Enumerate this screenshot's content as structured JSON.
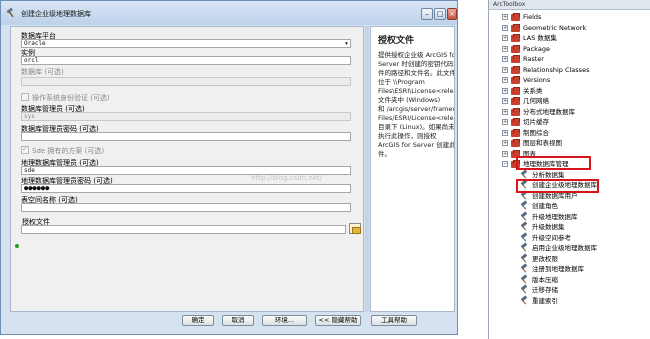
{
  "dialog": {
    "title": "创建企业级地理数据库",
    "buttons": {
      "ok": "确定",
      "cancel": "取消",
      "env": "环境...",
      "hide_help": "<< 隐藏帮助",
      "tool_help": "工具帮助"
    },
    "fields": {
      "platform_label": "数据库平台",
      "platform_value": "Oracle",
      "instance_label": "实例",
      "instance_value": "orcl",
      "database_label": "数据库 (可选)",
      "os_auth_label": "操作系统身份验证 (可选)",
      "db_admin_label": "数据库管理员 (可选)",
      "db_admin_value": "sys",
      "db_admin_pwd_label": "数据库管理员密码 (可选)",
      "sde_schema_label": "Sde 拥有的方案 (可选)",
      "gdb_admin_label": "地理数据库管理员 (可选)",
      "gdb_admin_value": "sde",
      "gdb_admin_pwd_label": "地理数据库管理员密码 (可选)",
      "gdb_admin_pwd_value": "●●●●●●",
      "tablespace_label": "表空间名称 (可选)",
      "auth_file_label": "授权文件"
    },
    "help": {
      "title": "授权文件",
      "body": "提供授权企业级 ArcGIS for\nServer 时创建的密钥代码文\n件的路径和文件名。此文件\n位于 \\\\Program\nFiles\\ESRI\\License<release#\n文件夹中 (Windows)\n和 /arcgis/server/framework/r\nFiles/ESRI/License<release#\n目录下 (Linux)。如果尚未\n执行此操作，则授权\nArcGIS for Server 创建此文\n件。"
    },
    "watermark": "http://blog.csdn.net/"
  },
  "toolbox": {
    "header": "ArcToolbox",
    "items": [
      {
        "label": "Fields",
        "kind": "box"
      },
      {
        "label": "Geometric Network",
        "kind": "box"
      },
      {
        "label": "LAS 数据集",
        "kind": "box"
      },
      {
        "label": "Package",
        "kind": "box"
      },
      {
        "label": "Raster",
        "kind": "box"
      },
      {
        "label": "Relationship Classes",
        "kind": "box"
      },
      {
        "label": "Versions",
        "kind": "box"
      },
      {
        "label": "关系类",
        "kind": "box"
      },
      {
        "label": "几何网络",
        "kind": "box"
      },
      {
        "label": "分布式地理数据库",
        "kind": "box"
      },
      {
        "label": "切片缓存",
        "kind": "box"
      },
      {
        "label": "制图综合",
        "kind": "box"
      },
      {
        "label": "图层和表视图",
        "kind": "box"
      },
      {
        "label": "图表",
        "kind": "box"
      },
      {
        "label": "地理数据库管理",
        "kind": "box"
      },
      {
        "label": "分析数据集",
        "kind": "tool"
      },
      {
        "label": "创建企业级地理数据库",
        "kind": "tool"
      },
      {
        "label": "创建数据库用户",
        "kind": "tool"
      },
      {
        "label": "创建角色",
        "kind": "tool"
      },
      {
        "label": "升级地理数据库",
        "kind": "tool"
      },
      {
        "label": "升级数据集",
        "kind": "tool"
      },
      {
        "label": "升级空间参考",
        "kind": "tool"
      },
      {
        "label": "启用企业级地理数据库",
        "kind": "tool"
      },
      {
        "label": "更改权限",
        "kind": "tool"
      },
      {
        "label": "注册到地理数据库",
        "kind": "tool"
      },
      {
        "label": "版本压缩",
        "kind": "tool"
      },
      {
        "label": "迁移存储",
        "kind": "tool"
      },
      {
        "label": "重建索引",
        "kind": "tool"
      }
    ]
  }
}
